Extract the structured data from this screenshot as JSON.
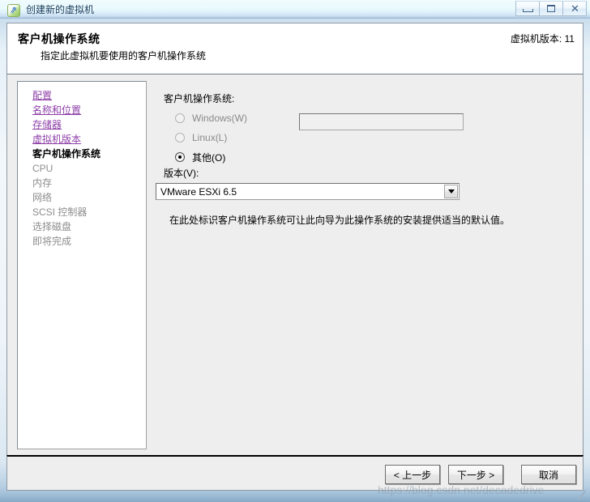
{
  "window": {
    "title": "创建新的虚拟机",
    "icon": "vm-wizard-icon",
    "controls": {
      "minimize": "minimize-icon",
      "maximize": "maximize-icon",
      "close": "close-icon"
    }
  },
  "header": {
    "title": "客户机操作系统",
    "subtitle": "指定此虚拟机要使用的客户机操作系统",
    "hardware_version": "虚拟机版本: 11"
  },
  "sidebar": {
    "items": [
      {
        "label": "配置",
        "state": "link"
      },
      {
        "label": "名称和位置",
        "state": "link"
      },
      {
        "label": "存储器",
        "state": "link"
      },
      {
        "label": "虚拟机版本",
        "state": "link"
      },
      {
        "label": "客户机操作系统",
        "state": "current"
      },
      {
        "label": "CPU",
        "state": "pending"
      },
      {
        "label": "内存",
        "state": "pending"
      },
      {
        "label": "网络",
        "state": "pending"
      },
      {
        "label": "SCSI 控制器",
        "state": "pending"
      },
      {
        "label": "选择磁盘",
        "state": "pending"
      },
      {
        "label": "即将完成",
        "state": "pending"
      }
    ]
  },
  "content": {
    "os_group_label": "客户机操作系统:",
    "radios": [
      {
        "label": "Windows(W)",
        "checked": false,
        "enabled": false
      },
      {
        "label": "Linux(L)",
        "checked": false,
        "enabled": false
      },
      {
        "label": "其他(O)",
        "checked": true,
        "enabled": true
      }
    ],
    "other_input": {
      "value": "",
      "placeholder": ""
    },
    "version_label": "版本(V):",
    "version_selected": "VMware ESXi 6.5",
    "version_arrow_icon": "chevron-down-icon",
    "hint": "在此处标识客户机操作系统可让此向导为此操作系统的安装提供适当的默认值。"
  },
  "footer": {
    "back_label": "< 上一步",
    "next_label": "下一步 >",
    "cancel_label": "取消"
  },
  "watermark": {
    "text": "https://blog.csdn.net/decadedrive"
  }
}
